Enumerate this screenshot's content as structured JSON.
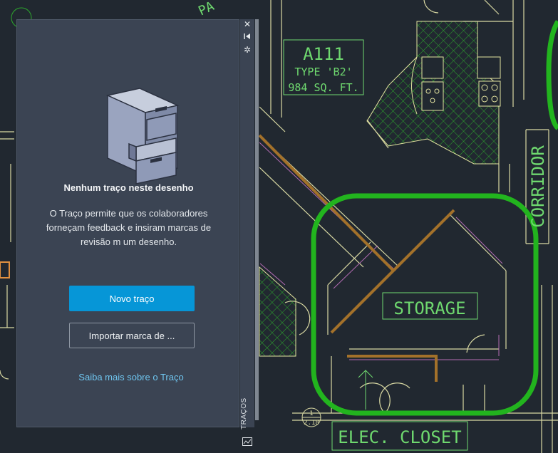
{
  "drawing": {
    "unit_label": "A111",
    "unit_type": "TYPE 'B2'",
    "unit_area": "984 SQ. FT.",
    "corridor_label": "CORRIDOR",
    "storage_label": "STORAGE",
    "closet_label": "ELEC. CLOSET",
    "callout_number": "1",
    "callout_sheet": "2.18",
    "partial_label_top": "PA"
  },
  "palette": {
    "strip_title": "TRAÇOS",
    "empty_title": "Nenhum traço neste desenho",
    "empty_body": "O Traço permite que os colaboradores forneçam feedback e insiram marcas de revisão m um desenho.",
    "new_button": "Novo traço",
    "import_button": "Importar marca de ...",
    "learn_link": "Saiba mais sobre o Traço"
  },
  "colors": {
    "background": "#212830",
    "palette_bg": "#3b4453",
    "primary_button": "#0696d7",
    "link": "#6fc6f0",
    "revision_cloud": "#22b41e",
    "cad_text": "#7ee07e",
    "walls": "#d9d9a3"
  },
  "icons": {
    "close": "close-icon",
    "pin": "pin-icon",
    "settings": "gear-icon",
    "palette_toggle": "palette-icon",
    "empty_state": "file-cabinet-icon"
  }
}
